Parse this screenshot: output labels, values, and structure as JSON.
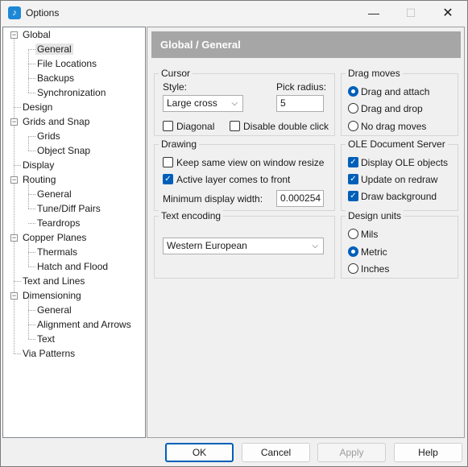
{
  "window": {
    "title": "Options"
  },
  "tree": {
    "items": [
      {
        "label": "Global",
        "level": 0
      },
      {
        "label": "General",
        "level": 1,
        "selected": true
      },
      {
        "label": "File Locations",
        "level": 1
      },
      {
        "label": "Backups",
        "level": 1
      },
      {
        "label": "Synchronization",
        "level": 1
      },
      {
        "label": "Design",
        "level": 0
      },
      {
        "label": "Grids and Snap",
        "level": 0
      },
      {
        "label": "Grids",
        "level": 1
      },
      {
        "label": "Object Snap",
        "level": 1
      },
      {
        "label": "Display",
        "level": 0
      },
      {
        "label": "Routing",
        "level": 0
      },
      {
        "label": "General",
        "level": 1
      },
      {
        "label": "Tune/Diff Pairs",
        "level": 1
      },
      {
        "label": "Teardrops",
        "level": 1
      },
      {
        "label": "Copper Planes",
        "level": 0
      },
      {
        "label": "Thermals",
        "level": 1
      },
      {
        "label": "Hatch and Flood",
        "level": 1
      },
      {
        "label": "Text and Lines",
        "level": 0
      },
      {
        "label": "Dimensioning",
        "level": 0
      },
      {
        "label": "General",
        "level": 1
      },
      {
        "label": "Alignment and Arrows",
        "level": 1
      },
      {
        "label": "Text",
        "level": 1
      },
      {
        "label": "Via Patterns",
        "level": 0
      }
    ]
  },
  "panel": {
    "header": "Global / General"
  },
  "cursor": {
    "legend": "Cursor",
    "style_label": "Style:",
    "style_value": "Large cross",
    "pick_radius_label": "Pick radius:",
    "pick_radius_value": "5",
    "diagonal_label": "Diagonal",
    "diagonal_checked": false,
    "disable_double_click_label": "Disable double click",
    "disable_double_click_checked": false
  },
  "drag_moves": {
    "legend": "Drag moves",
    "options": [
      "Drag and attach",
      "Drag and drop",
      "No drag moves"
    ],
    "selected": 0
  },
  "drawing": {
    "legend": "Drawing",
    "keep_same_view_label": "Keep same view on window resize",
    "keep_same_view_checked": false,
    "active_layer_label": "Active layer comes to front",
    "active_layer_checked": true,
    "min_display_width_label": "Minimum display width:",
    "min_display_width_value": "0.000254"
  },
  "ole": {
    "legend": "OLE Document Server",
    "display_ole_label": "Display OLE objects",
    "update_on_redraw_label": "Update on redraw",
    "draw_background_label": "Draw background"
  },
  "text_encoding": {
    "legend": "Text encoding",
    "value": "Western European"
  },
  "design_units": {
    "legend": "Design units",
    "options": [
      "Mils",
      "Metric",
      "Inches"
    ],
    "selected": 1
  },
  "buttons": {
    "ok": "OK",
    "cancel": "Cancel",
    "apply": "Apply",
    "help": "Help"
  },
  "colors": {
    "accent": "#005fb8",
    "header_band": "#a6a6a6"
  }
}
